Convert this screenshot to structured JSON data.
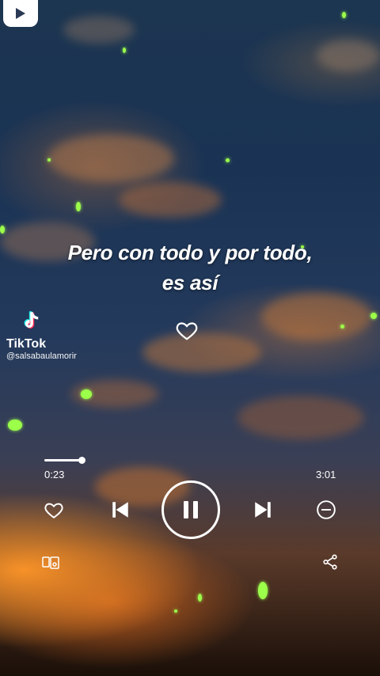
{
  "lyrics": {
    "line1": "Pero con todo y por todo,",
    "line2": "es así"
  },
  "watermark": {
    "brand": "TikTok",
    "handle": "@salsabaulamorir"
  },
  "player": {
    "elapsed": "0:23",
    "duration": "3:01",
    "progress_fraction": 0.127,
    "state": "playing"
  },
  "icons": {
    "corner_logo": "youtube-shorts-icon",
    "lyric_heart": "heart-outline-icon",
    "tiktok_logo": "tiktok-note-icon",
    "like": "heart-outline-icon",
    "previous": "skip-previous-icon",
    "pause": "pause-icon",
    "next": "skip-next-icon",
    "remove": "minus-circle-icon",
    "device": "devices-icon",
    "share": "share-icon"
  },
  "colors": {
    "spark": "#9cff4a",
    "sky_top": "#1c3550",
    "sunset": "#ff9628"
  }
}
